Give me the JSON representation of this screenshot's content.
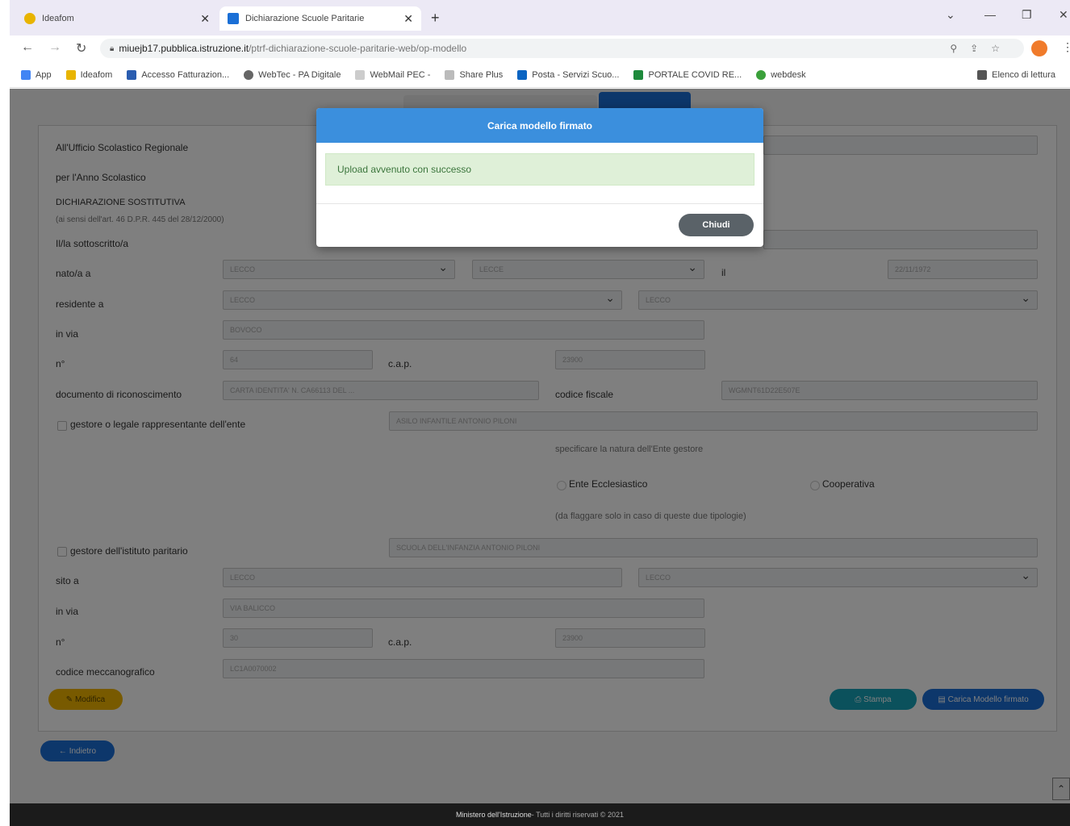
{
  "browser": {
    "tabs": [
      {
        "title": "Ideafom",
        "icon": "ideafom-icon"
      },
      {
        "title": "Dichiarazione Scuole Paritarie",
        "icon": "page-icon"
      }
    ],
    "new_tab": "+",
    "url_host": "miuejb17.pubblica.istruzione.it",
    "url_path": "/ptrf-dichiarazione-scuole-paritarie-web/op-modello",
    "bookmarks": [
      "App",
      "Ideafom",
      "Accesso Fatturazion...",
      "WebTec - PA Digitale",
      "WebMail PEC -",
      "Share Plus",
      "Posta - Servizi Scuo...",
      "PORTALE COVID RE...",
      "webdesk"
    ],
    "reading_list": "Elenco di lettura"
  },
  "form": {
    "address_line": "All'Ufficio Scolastico Regionale",
    "school_year_label": "per l'Anno Scolastico",
    "declaration_title": "DICHIARAZIONE SOSTITUTIVA",
    "declaration_subtitle": "(ai sensi dell'art. 46 D.P.R. 445 del 28/12/2000)",
    "signer_label": "Il/la sottoscritto/a",
    "born_label": "nato/a a",
    "on_label": "il",
    "resident_label": "residente a",
    "street_label": "in via",
    "number_label": "n°",
    "cap_label": "c.a.p.",
    "document_label": "documento di riconoscimento",
    "tax_code_label": "codice fiscale",
    "manager_label": "gestore o legale rappresentante dell'ente",
    "nature_label": "specificare la natura dell'Ente gestore",
    "ecclesiastic_label": "Ente Ecclesiastico",
    "cooperative_label": "Cooperativa",
    "flag_note": "(da flaggare solo in caso di queste due tipologie)",
    "institute_manager_label": "gestore dell'istituto paritario",
    "located_label": "sito a",
    "street2_label": "in via",
    "number2_label": "n°",
    "cap2_label": "c.a.p.",
    "mech_code_label": "codice meccanografico",
    "values": {
      "born_prov": "LECCO",
      "born_city": "LECCE",
      "birth_date": "22/11/1972",
      "res_prov": "LECCO",
      "res_city": "LECCO",
      "street": "BOVOCO",
      "number": "64",
      "cap": "23900",
      "document": "CARTA IDENTITA' N. CA66113 DEL ...",
      "tax_code": "WGMNT61D22E507E",
      "entity": "ASILO INFANTILE ANTONIO PILONI",
      "institute": "SCUOLA DELL'INFANZIA ANTONIO PILONI",
      "loc_prov": "LECCO",
      "loc_city": "LECCO",
      "street2": "VIA BALICCO",
      "number2": "30",
      "cap2": "23900",
      "mech_code": "LC1A0070002"
    }
  },
  "buttons": {
    "edit": "Modifica",
    "print": "Stampa",
    "upload": "Carica Modello firmato",
    "back": "Indietro"
  },
  "footer": {
    "ministry": "Ministero dell'Istruzione",
    "rights": " - Tutti i diritti riservati © 2021"
  },
  "modal": {
    "title": "Carica modello firmato",
    "message": "Upload avvenuto con successo",
    "close": "Chiudi"
  },
  "colors": {
    "modal_header": "#3b8fdd",
    "success_bg": "#dff0d8",
    "edit_btn": "#f0b400",
    "print_btn": "#17a2b8",
    "upload_btn": "#1a6fd6"
  }
}
